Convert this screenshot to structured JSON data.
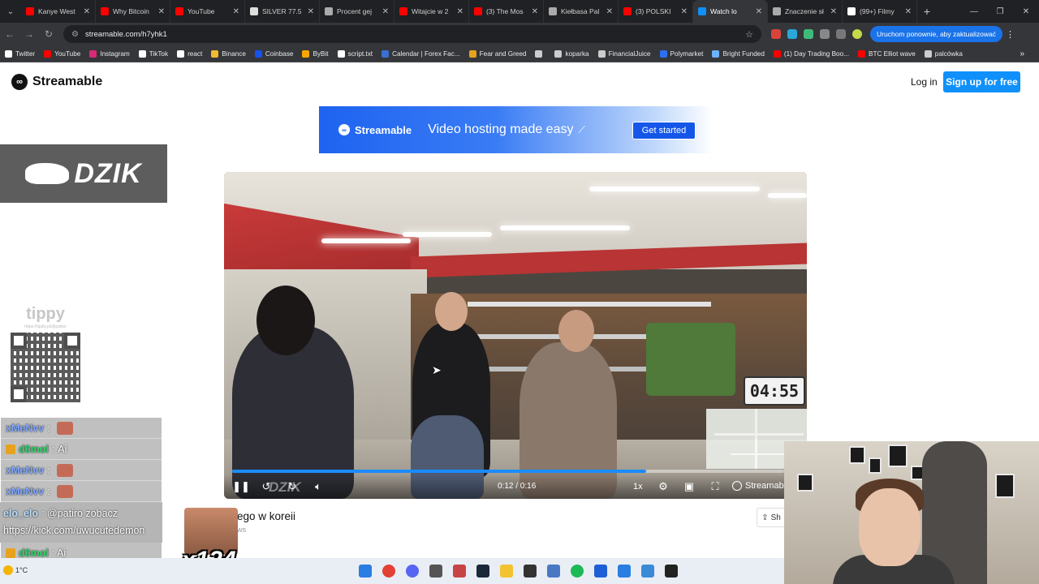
{
  "browser": {
    "tabs": [
      {
        "label": "Kanye West",
        "color": "#ff0000"
      },
      {
        "label": "Why Bitcoin",
        "color": "#ff0000"
      },
      {
        "label": "YouTube",
        "color": "#ff0000"
      },
      {
        "label": "SILVER 77.5",
        "color": "#dddddd"
      },
      {
        "label": "Procent gej",
        "color": "#aaaaaa"
      },
      {
        "label": "Witajcie w 2",
        "color": "#ff0000"
      },
      {
        "label": "(3) The Mos",
        "color": "#ff0000"
      },
      {
        "label": "Kiełbasa Pal",
        "color": "#aaaaaa"
      },
      {
        "label": "(3) POLSKI",
        "color": "#ff0000"
      },
      {
        "label": "Watch lo",
        "color": "#0f90fa",
        "active": true
      },
      {
        "label": "Znaczenie sł",
        "color": "#aaaaaa"
      },
      {
        "label": "(99+) Filmy",
        "color": "#ffffff"
      }
    ],
    "new_tab_label": "+",
    "url": "streamable.com/h7yhk1",
    "update_button": "Uruchom ponownie, aby zaktualizować",
    "bookmarks": [
      {
        "label": "Twitter",
        "color": "#ffffff"
      },
      {
        "label": "YouTube",
        "color": "#ff0000"
      },
      {
        "label": "Instagram",
        "color": "#d62976"
      },
      {
        "label": "TikTok",
        "color": "#ffffff"
      },
      {
        "label": "react",
        "color": "#ffffff"
      },
      {
        "label": "Binance",
        "color": "#f3ba2f"
      },
      {
        "label": "Coinbase",
        "color": "#1652f0"
      },
      {
        "label": "ByBit",
        "color": "#f7a600"
      },
      {
        "label": "script.txt",
        "color": "#ffffff"
      },
      {
        "label": "Calendar | Forex Fac...",
        "color": "#3b6fd1"
      },
      {
        "label": "Fear and Greed",
        "color": "#e8a21d"
      },
      {
        "label": "",
        "color": "#cccccc"
      },
      {
        "label": "koparka",
        "color": "#cccccc"
      },
      {
        "label": "FinancialJuice",
        "color": "#cccccc"
      },
      {
        "label": "Polymarket",
        "color": "#2d6ff2"
      },
      {
        "label": "Bright Funded",
        "color": "#6cb2ff"
      },
      {
        "label": "(1) Day Trading Boo...",
        "color": "#ff0000"
      },
      {
        "label": "BTC Elliot wave",
        "color": "#ff0000"
      },
      {
        "label": "palcówka",
        "color": "#cccccc"
      }
    ]
  },
  "streamable": {
    "logo": "Streamable",
    "login": "Log in",
    "signup": "Sign up for free",
    "banner": {
      "brand": "Streamable",
      "tagline": "Video hosting made easy",
      "cta": "Get started"
    },
    "player": {
      "time": "0:12 / 0:16",
      "speed": "1x",
      "progress": 0.75,
      "brand": "Streamable",
      "camera_timer": "04:55",
      "watermark": "DZIK"
    },
    "video_title": "ego w koreii",
    "video_views": "ws",
    "share_label": "Sh"
  },
  "overlays": {
    "dzik_logo": "DZIK",
    "tippy_logo": "tippy",
    "tippy_url": "https://tipply.pl/@patwo",
    "chat": [
      {
        "user": "xMeNvv",
        "sep": ":",
        "message": "",
        "emote": true,
        "user_color": "#7fa8ff"
      },
      {
        "user": "d0mol",
        "sep": ":",
        "message": "Ai",
        "emote": false,
        "user_color": "#2fd46a"
      },
      {
        "user": "xMeNvv",
        "sep": ":",
        "message": "",
        "emote": true,
        "user_color": "#7fa8ff"
      },
      {
        "user": "xMeNvv",
        "sep": ":",
        "message": "",
        "emote": true,
        "user_color": "#7fa8ff"
      }
    ],
    "chat_long": {
      "user": "elo_elo",
      "message": ": @patiro zobacz https://kick.com/uwucutedemon"
    },
    "chat_last": {
      "user": "d0mol",
      "message": ": Ai"
    },
    "emote_count": "x124",
    "weather_temp": "1°C"
  }
}
